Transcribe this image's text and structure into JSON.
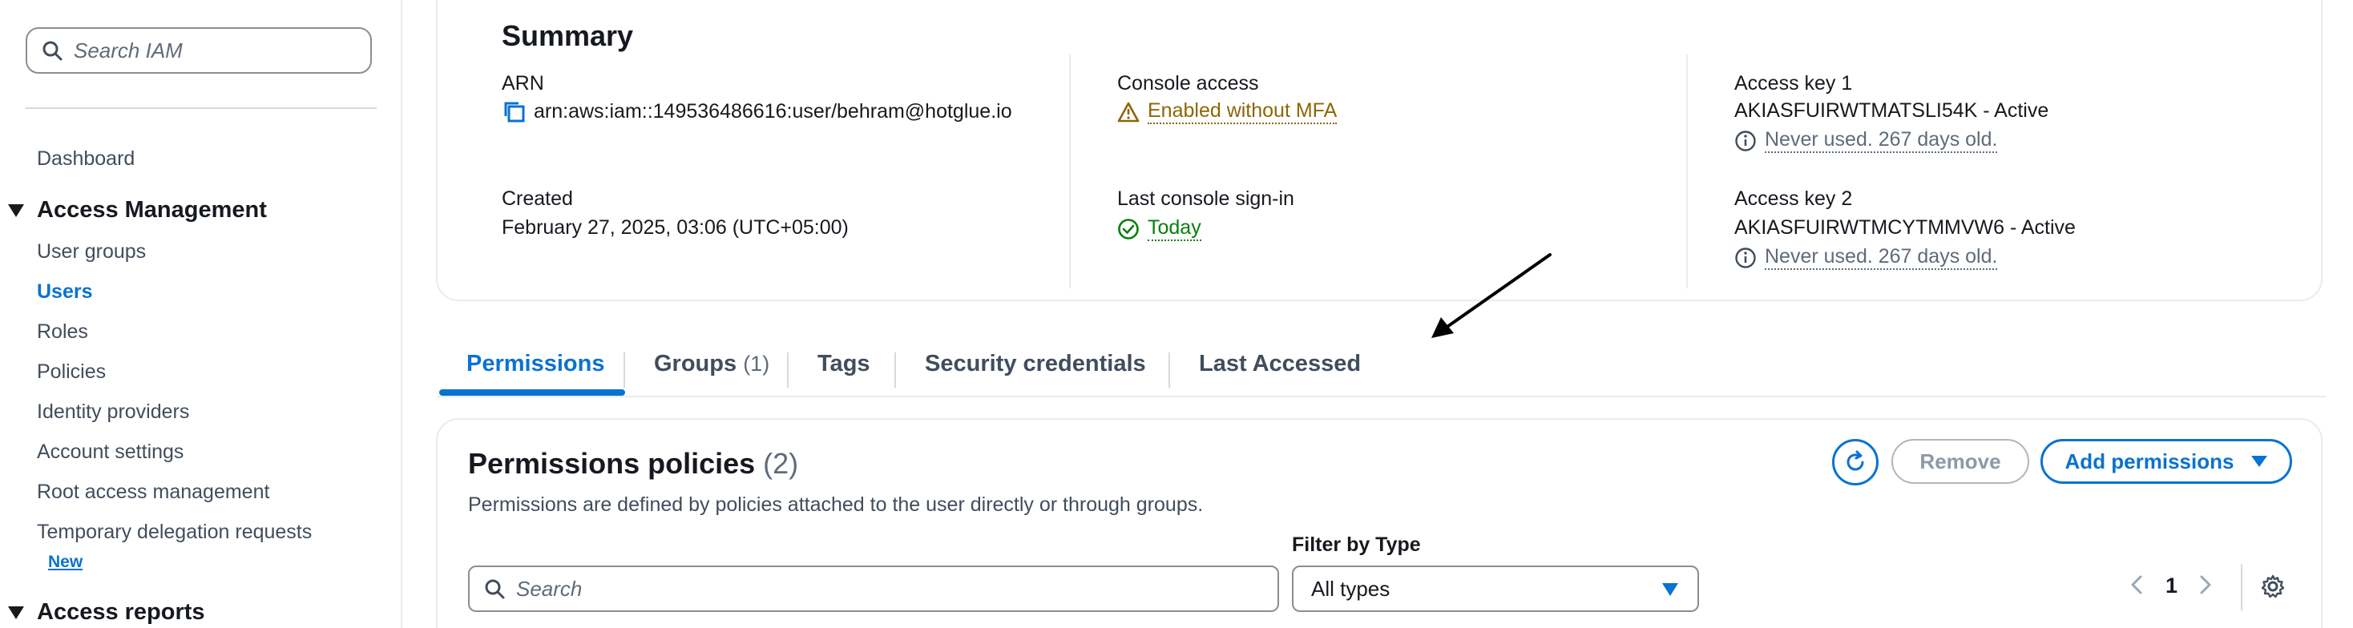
{
  "sidebar": {
    "search_placeholder": "Search IAM",
    "dashboard": "Dashboard",
    "access_management": {
      "title": "Access Management",
      "items": [
        "User groups",
        "Users",
        "Roles",
        "Policies",
        "Identity providers",
        "Account settings",
        "Root access management",
        "Temporary delegation requests"
      ],
      "active": "Users",
      "new_badge": "New"
    },
    "access_reports": {
      "title": "Access reports"
    }
  },
  "summary": {
    "title": "Summary",
    "arn": {
      "label": "ARN",
      "value": "arn:aws:iam::149536486616:user/behram@hotglue.io"
    },
    "created": {
      "label": "Created",
      "value": "February 27, 2025, 03:06 (UTC+05:00)"
    },
    "console_access": {
      "label": "Console access",
      "value": "Enabled without MFA"
    },
    "last_signin": {
      "label": "Last console sign-in",
      "value": "Today"
    },
    "access_key_1": {
      "label": "Access key 1",
      "value": "AKIASFUIRWTMATSLI54K - Active",
      "note": "Never used. 267 days old."
    },
    "access_key_2": {
      "label": "Access key 2",
      "value": "AKIASFUIRWTMCYTMMVW6 - Active",
      "note": "Never used. 267 days old."
    }
  },
  "tabs": [
    {
      "label": "Permissions",
      "active": true
    },
    {
      "label": "Groups",
      "count": "(1)"
    },
    {
      "label": "Tags"
    },
    {
      "label": "Security credentials"
    },
    {
      "label": "Last Accessed"
    }
  ],
  "permissions": {
    "title": "Permissions policies",
    "count": "(2)",
    "description": "Permissions are defined by policies attached to the user directly or through groups.",
    "buttons": {
      "remove": "Remove",
      "add": "Add permissions"
    },
    "filter_label": "Filter by Type",
    "search_placeholder": "Search",
    "filter_value": "All types",
    "page": "1"
  },
  "colors": {
    "accent": "#0972d3",
    "warning": "#8d6605",
    "success": "#037f0c",
    "muted": "#5f6b7a"
  }
}
